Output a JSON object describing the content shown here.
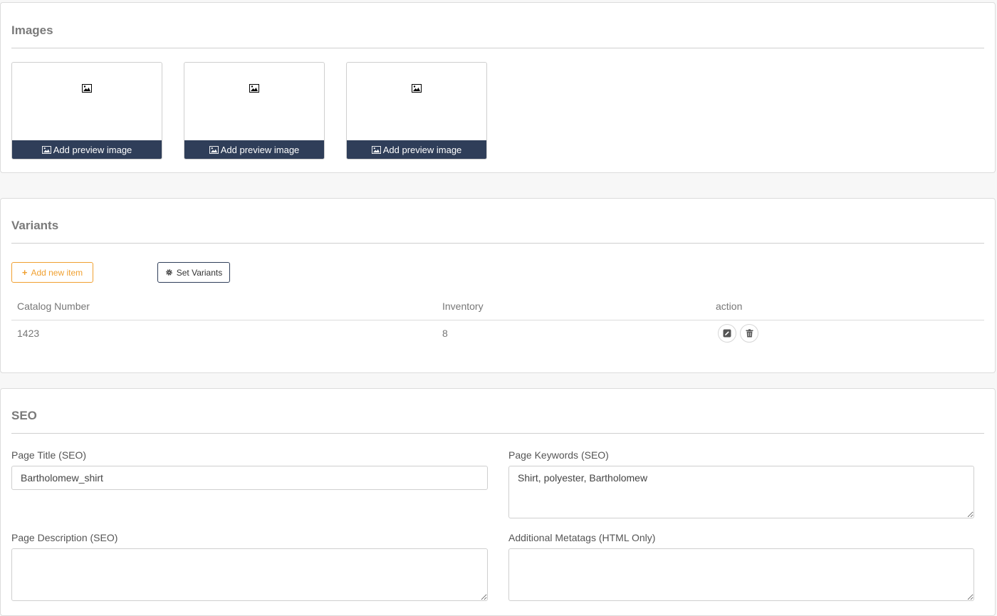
{
  "images": {
    "title": "Images",
    "tiles": [
      {
        "button_label": "Add preview image"
      },
      {
        "button_label": "Add preview image"
      },
      {
        "button_label": "Add preview image"
      }
    ]
  },
  "variants": {
    "title": "Variants",
    "add_button": "Add new item",
    "set_button": "Set Variants",
    "columns": [
      "Catalog Number",
      "Inventory",
      "action"
    ],
    "rows": [
      {
        "catalog_number": "1423",
        "inventory": "8"
      }
    ]
  },
  "seo": {
    "title": "SEO",
    "page_title_label": "Page Title (SEO)",
    "page_title_value": "Bartholomew_shirt",
    "page_keywords_label": "Page Keywords (SEO)",
    "page_keywords_value": "Shirt, polyester, Bartholomew",
    "page_description_label": "Page Description (SEO)",
    "page_description_value": "",
    "metatags_label": "Additional Metatags (HTML Only)",
    "metatags_value": ""
  },
  "colors": {
    "button_navy": "#2f3e59",
    "accent_orange": "#f0a030",
    "page_bg": "#f7f7f7"
  }
}
